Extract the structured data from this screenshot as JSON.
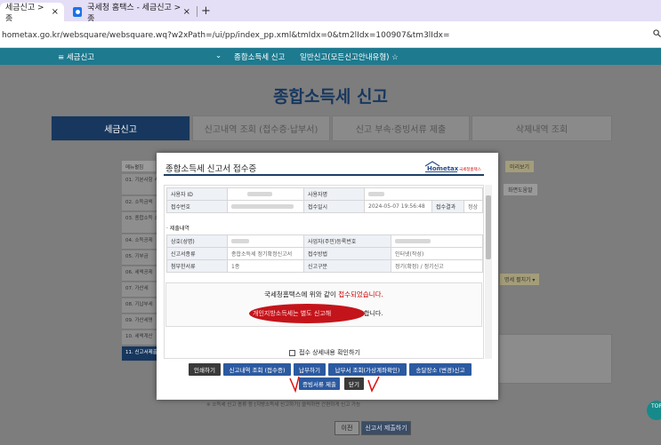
{
  "browser": {
    "tabs": [
      {
        "title": "세금신고 > 종",
        "close": "×"
      },
      {
        "title": "국세청 홈택스 - 세금신고 > 종",
        "close": "×"
      }
    ],
    "new_tab": "+",
    "url": "hometax.go.kr/websquare/websquare.wq?w2xPath=/ui/pp/index_pp.xml&tmIdx=0&tm2lIdx=100907&tm3lIdx=",
    "zoom_icon": "magnifier-icon"
  },
  "nav": {
    "menu": "≡  세금신고",
    "chevron": "⌄",
    "crumb1": "종합소득세 신고",
    "crumb2": "일반신고(모든신고안내유형) ☆"
  },
  "page": {
    "title": "종합소득세 신고",
    "tabs": [
      "세금신고",
      "신고내역 조회 (접수증·납부서)",
      "신고 부속·증빙서류 제출",
      "삭제내역 조회"
    ],
    "side_head": "메뉴펼침",
    "side_items": [
      "01. 기본사항 사업장",
      "02. 소득금액",
      "03. 종합소득 소득금액",
      "04. 소득공제",
      "05. 기부금",
      "06. 세액공제",
      "07. 가산세",
      "08. 기납부세",
      "09. 가산세명",
      "10. 세액계산",
      "11. 신고서제출"
    ],
    "right_btn1": "미리보기",
    "right_btn2": "화면도움말",
    "right_btn3": "명세 펼치기 ▾",
    "bottom_note": "※ 소득세 신고 종류 등 [지방소득세 신고하기] 클릭하면 간편하게 신고 가능",
    "prev": "이전",
    "submit": "신고서 제출하기",
    "fab": "TOP"
  },
  "modal": {
    "title": "종합소득세 신고서 접수증",
    "logo_text": "Hometax",
    "logo_sub": "국세청홈택스",
    "rows1": [
      {
        "h1": "사용자 ID",
        "v1": "",
        "h2": "사용자명",
        "v2": ""
      },
      {
        "h1": "접수번호",
        "v1": "",
        "h2": "접수일시",
        "v2": "2024-05-07 19:56:48",
        "h3": "접수결과",
        "v3": "정상"
      }
    ],
    "section": "· 제출내역",
    "rows2": [
      {
        "h1": "상호(성명)",
        "v1": "",
        "h2": "사업자(주민)등록번호",
        "v2": ""
      },
      {
        "h1": "신고서종류",
        "v1": "종합소득세 정기확정신고서",
        "h2": "접수방법",
        "v2": "인터넷(작성)"
      },
      {
        "h1": "첨부한서류",
        "v1": "1종",
        "h2": "신고구분",
        "v2": "정기(확정) / 정기신고"
      }
    ],
    "msg1_a": "국세청홈택스에 위와 같이 ",
    "msg1_b": "접수되었습니다.",
    "msg2_a": "개인지방소득세는 별도 신고해",
    "msg2_b": "합니다.",
    "checkbox": "접수 상세내용 확인하기",
    "buttons1": [
      "인쇄하기",
      "신고내역 조회 (접수증)",
      "납부하기",
      "납부서 조회(가상계좌확인)",
      "송달장소 (변경)신고"
    ],
    "buttons2": [
      "증빙서류 제출",
      "닫기"
    ]
  }
}
